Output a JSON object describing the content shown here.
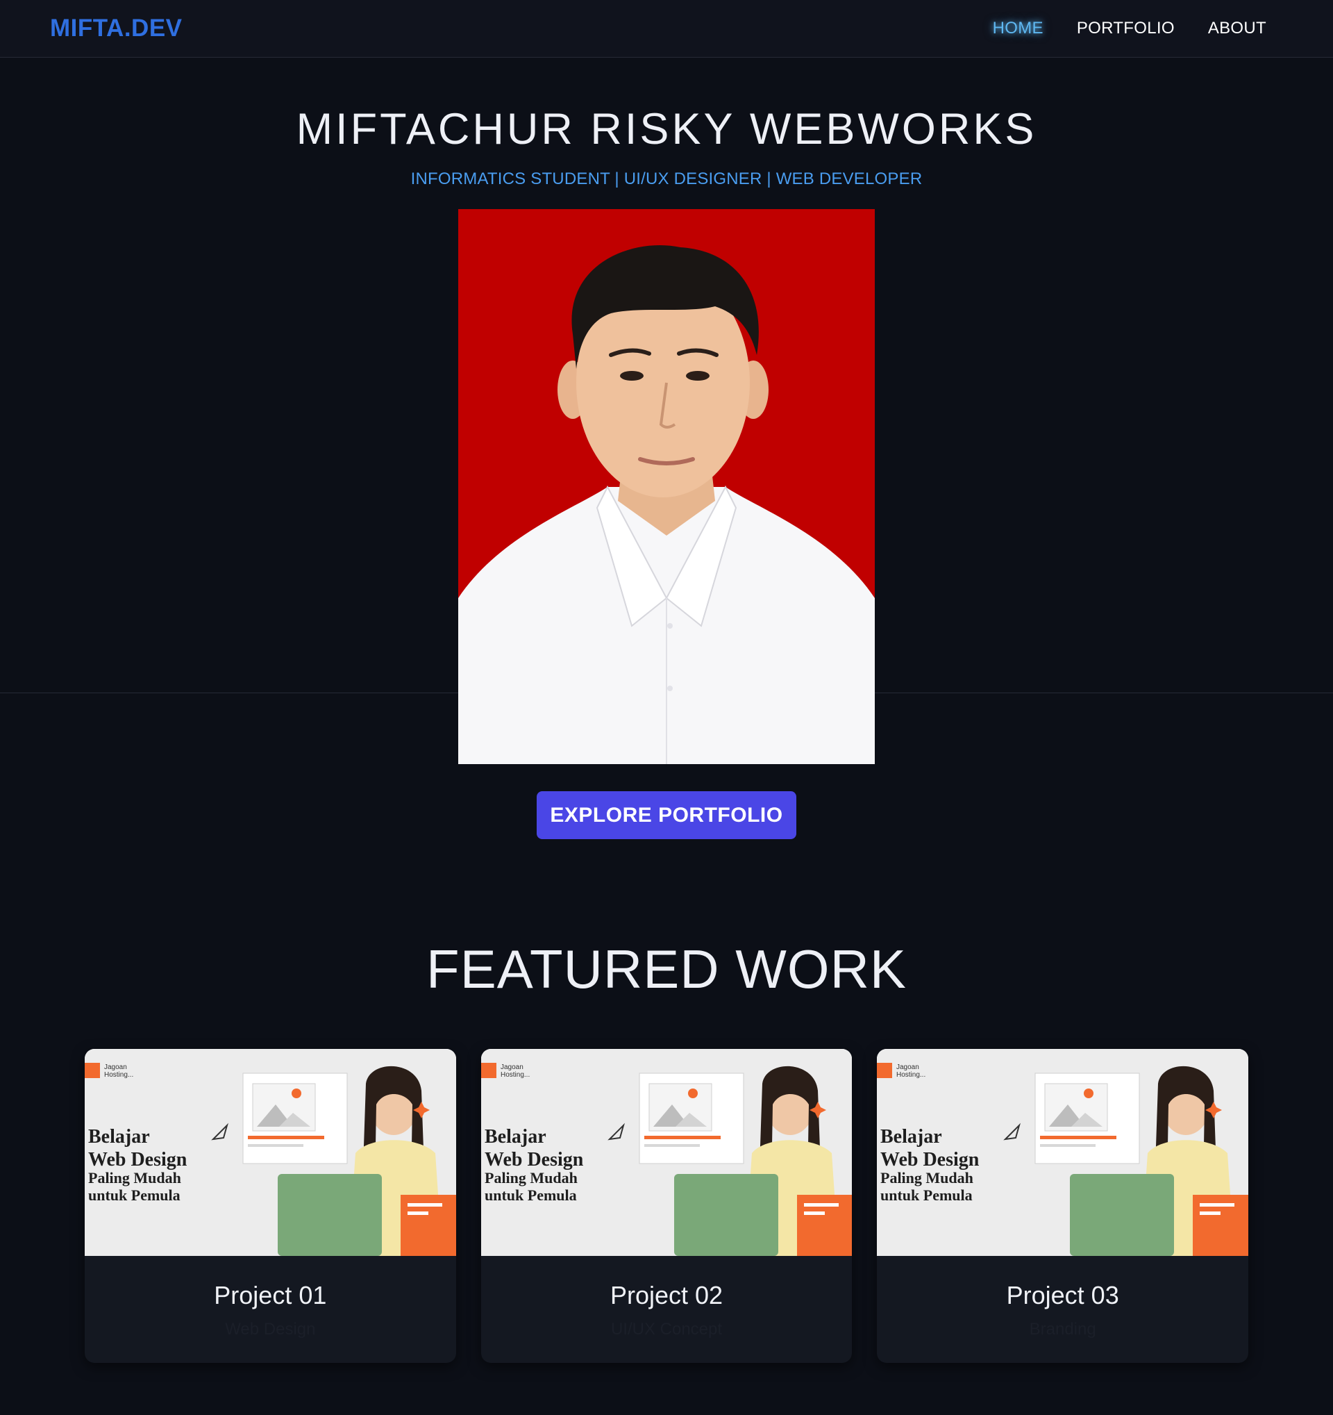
{
  "navbar": {
    "brand": "MIFTA.DEV",
    "links": [
      {
        "label": "HOME",
        "active": true
      },
      {
        "label": "PORTFOLIO",
        "active": false
      },
      {
        "label": "ABOUT",
        "active": false
      }
    ]
  },
  "hero": {
    "title": "MIFTACHUR RISKY WEBWORKS",
    "subtitle": "INFORMATICS STUDENT | UI/UX DESIGNER | WEB DEVELOPER",
    "cta_label": "EXPLORE PORTFOLIO"
  },
  "featured": {
    "title": "FEATURED WORK",
    "thumbnail": {
      "brand_line1": "Jagoan",
      "brand_line2": "Hosting...",
      "heading_line1": "Belajar",
      "heading_line2": "Web Design",
      "heading_line3": "Paling Mudah",
      "heading_line4": "untuk Pemula"
    },
    "projects": [
      {
        "title": "Project 01",
        "tag": "Web Design"
      },
      {
        "title": "Project 02",
        "tag": "UI/UX Concept"
      },
      {
        "title": "Project 03",
        "tag": "Branding"
      }
    ]
  },
  "colors": {
    "background": "#0c0f17",
    "brand": "#2f6fe0",
    "nav_active": "#5fb8f2",
    "subtitle": "#4a9df0",
    "cta": "#4a46e6",
    "portrait_background": "#c00000",
    "thumb_accent": "#f26a2e"
  }
}
